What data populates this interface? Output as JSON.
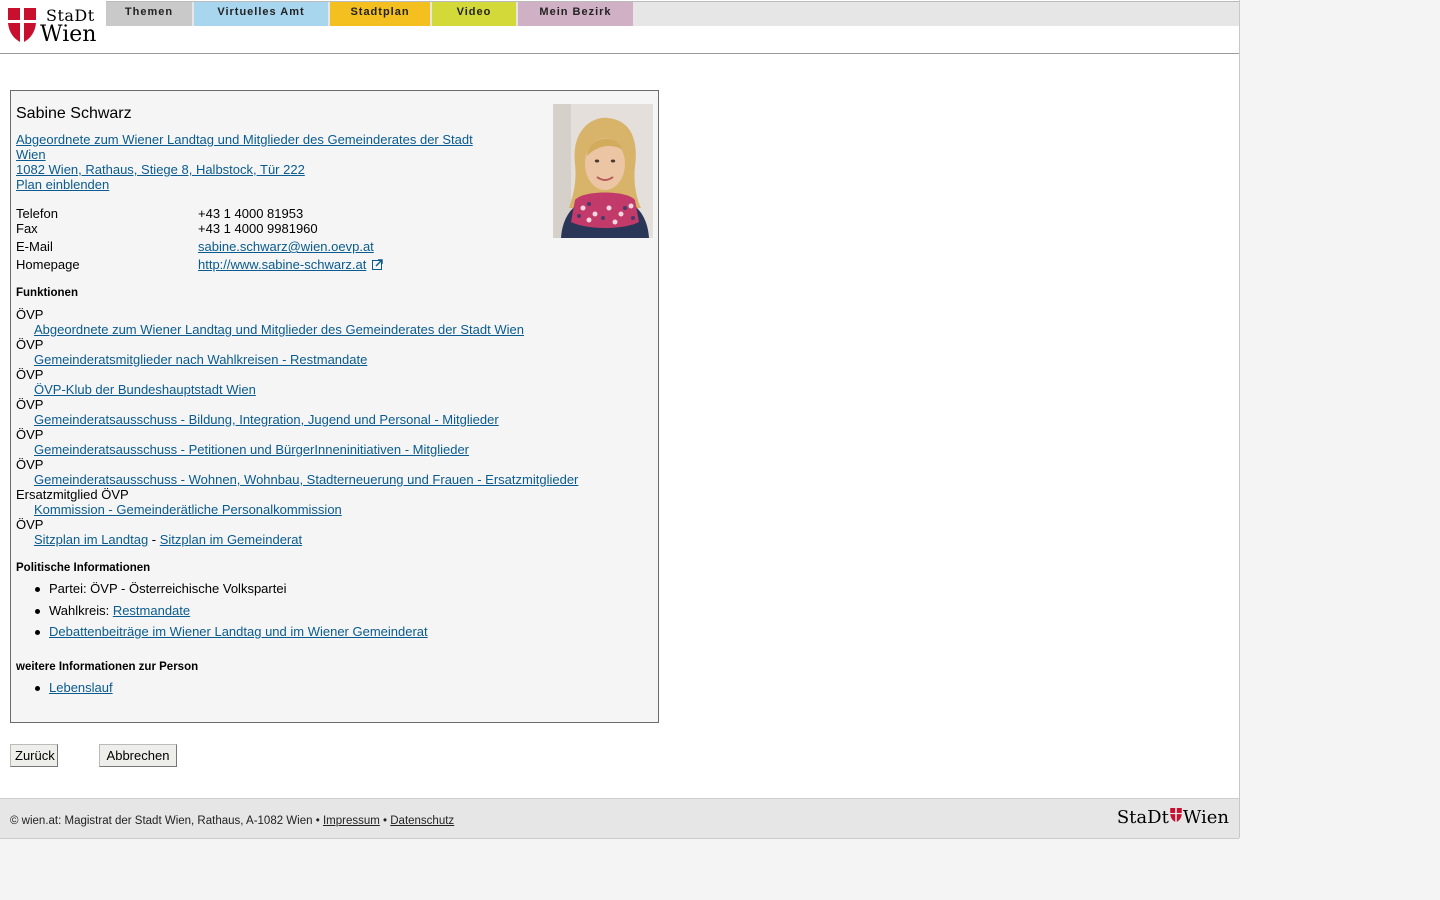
{
  "brand": {
    "stadt": "StaDt",
    "wien": "Wien",
    "colors": {
      "red": "#c8102e"
    }
  },
  "nav": {
    "tabs": [
      {
        "label": "Themen",
        "color": "#c9c9c9"
      },
      {
        "label": "Virtuelles Amt",
        "color": "#a9d6ef"
      },
      {
        "label": "Stadtplan",
        "color": "#f4c020"
      },
      {
        "label": "Video",
        "color": "#d4d93a"
      },
      {
        "label": "Mein Bezirk",
        "color": "#d0b0c4"
      }
    ]
  },
  "person": {
    "name": "Sabine Schwarz",
    "role_link_line1": "Abgeordnete zum Wiener Landtag und Mitglieder des Gemeinderates der Stadt",
    "role_link_line2": "Wien",
    "address": "1082 Wien, Rathaus, Stiege 8, Halbstock, Tür 222",
    "plan_link": "Plan einblenden",
    "photo_icon": "portrait-photo",
    "contact": {
      "phone_label": "Telefon",
      "phone": "+43 1 4000 81953",
      "fax_label": "Fax",
      "fax": "+43 1 4000 9981960",
      "email_label": "E-Mail",
      "email": "sabine.schwarz@wien.oevp.at",
      "homepage_label": "Homepage",
      "homepage": "http://www.sabine-schwarz.at",
      "external_icon": "external-link-icon"
    }
  },
  "functions": {
    "title": "Funktionen",
    "items": [
      {
        "party": "ÖVP",
        "link": "Abgeordnete zum Wiener Landtag und Mitglieder des Gemeinderates der Stadt Wien"
      },
      {
        "party": "ÖVP",
        "link": "Gemeinderatsmitglieder nach Wahlkreisen - Restmandate"
      },
      {
        "party": "ÖVP",
        "link": "ÖVP-Klub der Bundeshauptstadt Wien"
      },
      {
        "party": "ÖVP",
        "link": "Gemeinderatsausschuss - Bildung, Integration, Jugend und Personal - Mitglieder"
      },
      {
        "party": "ÖVP",
        "link": "Gemeinderatsausschuss - Petitionen und BürgerInneninitiativen - Mitglieder"
      },
      {
        "party": "ÖVP",
        "link": "Gemeinderatsausschuss - Wohnen, Wohnbau, Stadterneuerung und Frauen - Ersatzmitglieder"
      },
      {
        "party": "Ersatzmitglied ÖVP",
        "link": "Kommission - Gemeinderätliche Personalkommission"
      }
    ],
    "last_party": "ÖVP",
    "seat_landtag": "Sitzplan im Landtag",
    "seat_sep": " - ",
    "seat_gemeinderat": "Sitzplan im Gemeinderat"
  },
  "political": {
    "title": "Politische Informationen",
    "party_text": "Partei: ÖVP - Österreichische Volkspartei",
    "wahlkreis_label": "Wahlkreis: ",
    "wahlkreis_link": "Restmandate",
    "debate_link": "Debattenbeiträge im Wiener Landtag und im Wiener Gemeinderat"
  },
  "more": {
    "title": "weitere Informationen zur Person",
    "cv_link": "Lebenslauf"
  },
  "buttons": {
    "back": "Zurück",
    "cancel": "Abbrechen"
  },
  "footer": {
    "copyright": "© wien.at: Magistrat der Stadt Wien, Rathaus, A-1082 Wien •",
    "impressum": "Impressum",
    "sep": "•",
    "datenschutz": "Datenschutz",
    "logo_stadt": "StaDt",
    "logo_wien": "Wien"
  }
}
